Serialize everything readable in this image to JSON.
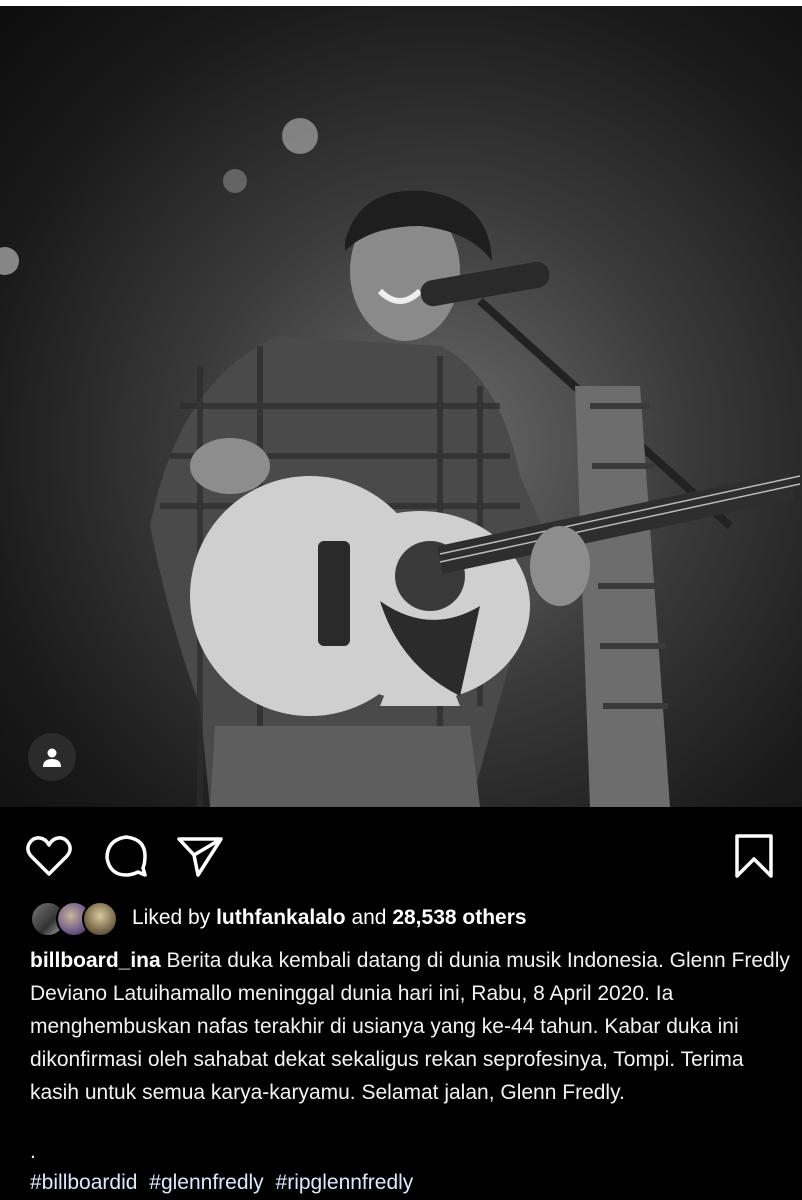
{
  "post": {
    "likes": {
      "prefix": "Liked by",
      "user": "luthfankalalo",
      "middle": "and",
      "count": "28,538 others"
    },
    "caption": {
      "username": "billboard_ina",
      "text": "Berita duka kembali datang di dunia musik Indonesia. Glenn Fredly Deviano Latuihamallo meninggal dunia hari ini, Rabu, 8 April 2020. Ia menghembuskan nafas terakhir di usianya yang ke-44 tahun. Kabar duka ini dikonfirmasi oleh sahabat dekat sekaligus rekan seprofesinya, Tompi. Terima kasih untuk semua karya-karyamu. Selamat jalan, Glenn Fredly."
    },
    "separator": ".",
    "hashtags": [
      "#billboardid",
      "#glennfredly",
      "#ripglennfredly"
    ]
  },
  "icons": {
    "like": "heart-icon",
    "comment": "comment-icon",
    "share": "send-icon",
    "save": "bookmark-icon",
    "tag": "user-tag-icon"
  },
  "colors": {
    "background": "#000000",
    "text": "#ffffff",
    "hashtag": "#e0e8ff"
  }
}
